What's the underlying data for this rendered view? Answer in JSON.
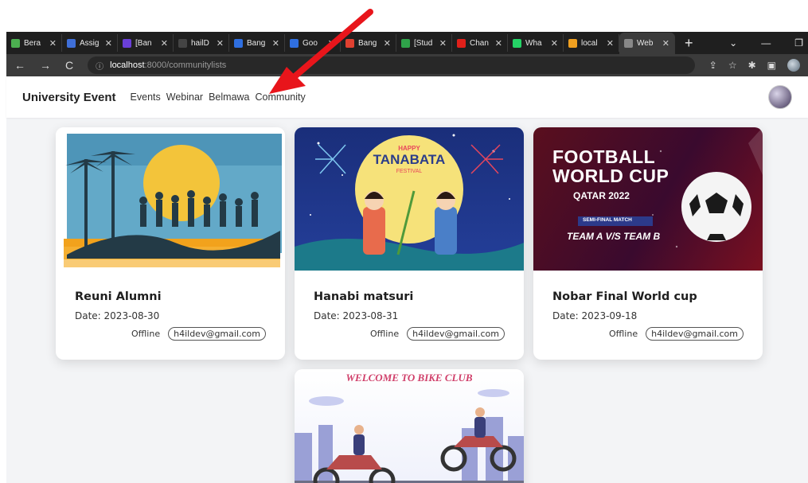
{
  "browser": {
    "tabs": [
      {
        "title": "Bera",
        "color": "#4caf50"
      },
      {
        "title": "Assig",
        "color": "#3f6fd8"
      },
      {
        "title": "[Ban",
        "color": "#6a3fd8"
      },
      {
        "title": "hailD",
        "color": "#444444"
      },
      {
        "title": "Bang",
        "color": "#2f6fe0"
      },
      {
        "title": "Goo",
        "color": "#2f6fe0"
      },
      {
        "title": "Bang",
        "color": "#e04030"
      },
      {
        "title": "[Stud",
        "color": "#2fa24a"
      },
      {
        "title": "Chan",
        "color": "#e0201a"
      },
      {
        "title": "Wha",
        "color": "#25d366"
      },
      {
        "title": "local",
        "color": "#f0a020"
      },
      {
        "title": "Web",
        "color": "#888888"
      }
    ],
    "url_host": "localhost",
    "url_path": ":8000/communitylists"
  },
  "navbar": {
    "brand": "University Event",
    "menu": [
      "Events",
      "Webinar",
      "Belmawa",
      "Community"
    ]
  },
  "cards": [
    {
      "title": "Reuni Alumni",
      "date": "Date: 2023-08-30",
      "mode": "Offline",
      "email": "h4ildev@gmail.com"
    },
    {
      "title": "Hanabi matsuri",
      "date": "Date: 2023-08-31",
      "mode": "Offline",
      "email": "h4ildev@gmail.com"
    },
    {
      "title": "Nobar Final World cup",
      "date": "Date: 2023-09-18",
      "mode": "Offline",
      "email": "h4ildev@gmail.com"
    }
  ],
  "images": {
    "tanabata_line1": "HAPPY",
    "tanabata_line2": "TANABATA",
    "tanabata_line3": "FESTIVAL",
    "football_line1": "FOOTBALL",
    "football_line2": "WORLD CUP",
    "football_line3": "QATAR 2022",
    "football_line4": "SEMI-FINAL MATCH",
    "football_line5": "TEAM A V/S TEAM B",
    "bike_title": "WELCOME TO BIKE CLUB"
  },
  "colors": {
    "annotation_arrow": "#e8151b"
  }
}
